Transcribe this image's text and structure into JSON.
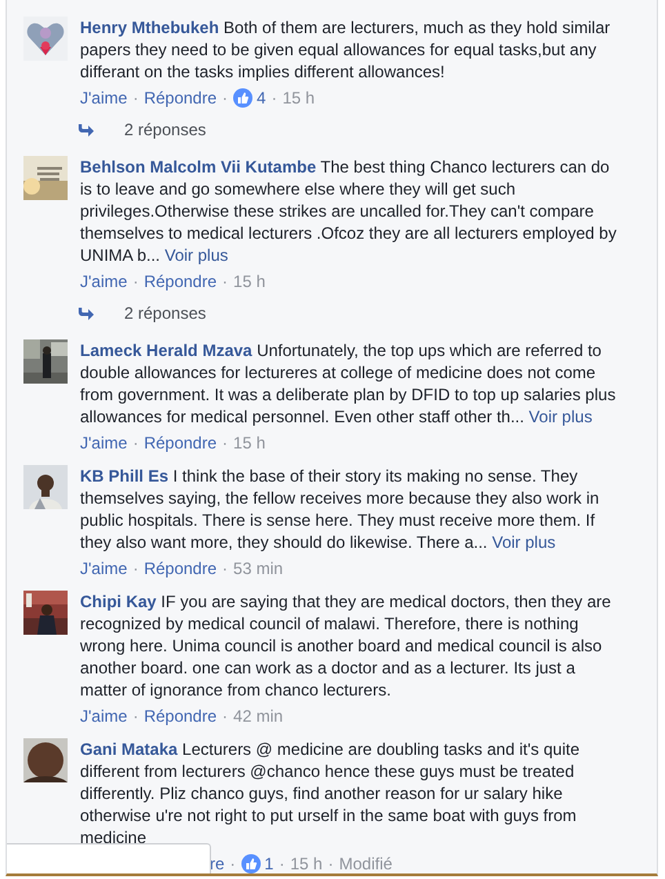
{
  "comments": [
    {
      "author": "Henry Mthebukeh",
      "text": "Both of them are lecturers, much as they hold similar papers they need to be given equal allowances for equal tasks,but any differant on the tasks implies different allowances!",
      "actions": [
        {
          "kind": "link",
          "text": "J'aime"
        },
        {
          "kind": "separator",
          "text": "·"
        },
        {
          "kind": "link",
          "text": "Répondre"
        },
        {
          "kind": "separator",
          "text": "·"
        },
        {
          "kind": "likes",
          "text": "4"
        },
        {
          "kind": "separator",
          "text": "·"
        },
        {
          "kind": "time",
          "text": "15 h"
        }
      ],
      "replies": "2 réponses"
    },
    {
      "author": "Behlson Malcolm Vii Kutambe",
      "text": "The best thing Chanco lecturers can do is to leave and go somewhere else where they will get such privileges.Otherwise these strikes are uncalled for.They can't compare themselves to medical lecturers .Ofcoz they are all lecturers employed by UNIMA b...",
      "more": "Voir plus",
      "actions": [
        {
          "kind": "link",
          "text": "J'aime"
        },
        {
          "kind": "separator",
          "text": "·"
        },
        {
          "kind": "link",
          "text": "Répondre"
        },
        {
          "kind": "separator",
          "text": "·"
        },
        {
          "kind": "time",
          "text": "15 h"
        }
      ],
      "replies": "2 réponses"
    },
    {
      "author": "Lameck Herald Mzava",
      "text": "Unfortunately, the top ups which are referred to double allowances for lectureres at college of medicine does not come from government. It was a deliberate plan by DFID to top up salaries plus allowances for medical personnel. Even other staff other th...",
      "more": "Voir plus",
      "actions": [
        {
          "kind": "link",
          "text": "J'aime"
        },
        {
          "kind": "separator",
          "text": "·"
        },
        {
          "kind": "link",
          "text": "Répondre"
        },
        {
          "kind": "separator",
          "text": "·"
        },
        {
          "kind": "time",
          "text": "15 h"
        }
      ]
    },
    {
      "author": "KB Phill Es",
      "text": "I think the base of their story its making no sense. They themselves saying, the fellow receives more because they also work in public hospitals. There is sense here. They must receive more them. If they also want more, they should do likewise. There a...",
      "more": "Voir plus",
      "actions": [
        {
          "kind": "link",
          "text": "J'aime"
        },
        {
          "kind": "separator",
          "text": "·"
        },
        {
          "kind": "link",
          "text": "Répondre"
        },
        {
          "kind": "separator",
          "text": "·"
        },
        {
          "kind": "time",
          "text": "53 min"
        }
      ]
    },
    {
      "author": "Chipi Kay",
      "text": "IF you are saying that they are medical doctors, then they are recognized by medical council of malawi. Therefore, there is nothing wrong here. Unima council is another board and medical council is also another board. one can work as a doctor and as a lecturer. Its just a matter of ignorance from chanco lecturers.",
      "actions": [
        {
          "kind": "link",
          "text": "J'aime"
        },
        {
          "kind": "separator",
          "text": "·"
        },
        {
          "kind": "link",
          "text": "Répondre"
        },
        {
          "kind": "separator",
          "text": "·"
        },
        {
          "kind": "time",
          "text": "42 min"
        }
      ]
    },
    {
      "author": "Gani Mataka",
      "text": "Lecturers @ medicine are doubling tasks and it's quite different from lecturers @chanco hence these guys must be treated differently. Pliz chanco guys, find another reason for ur salary hike otherwise u're not right to put urself in the same boat with guys from medicine",
      "covered": true,
      "actions": [
        {
          "kind": "link",
          "text": "re"
        },
        {
          "kind": "separator",
          "text": "·"
        },
        {
          "kind": "likes",
          "text": "1"
        },
        {
          "kind": "separator",
          "text": "·"
        },
        {
          "kind": "time",
          "text": "15 h"
        },
        {
          "kind": "separator",
          "text": "·"
        },
        {
          "kind": "time",
          "text": "Modifié"
        }
      ]
    }
  ]
}
